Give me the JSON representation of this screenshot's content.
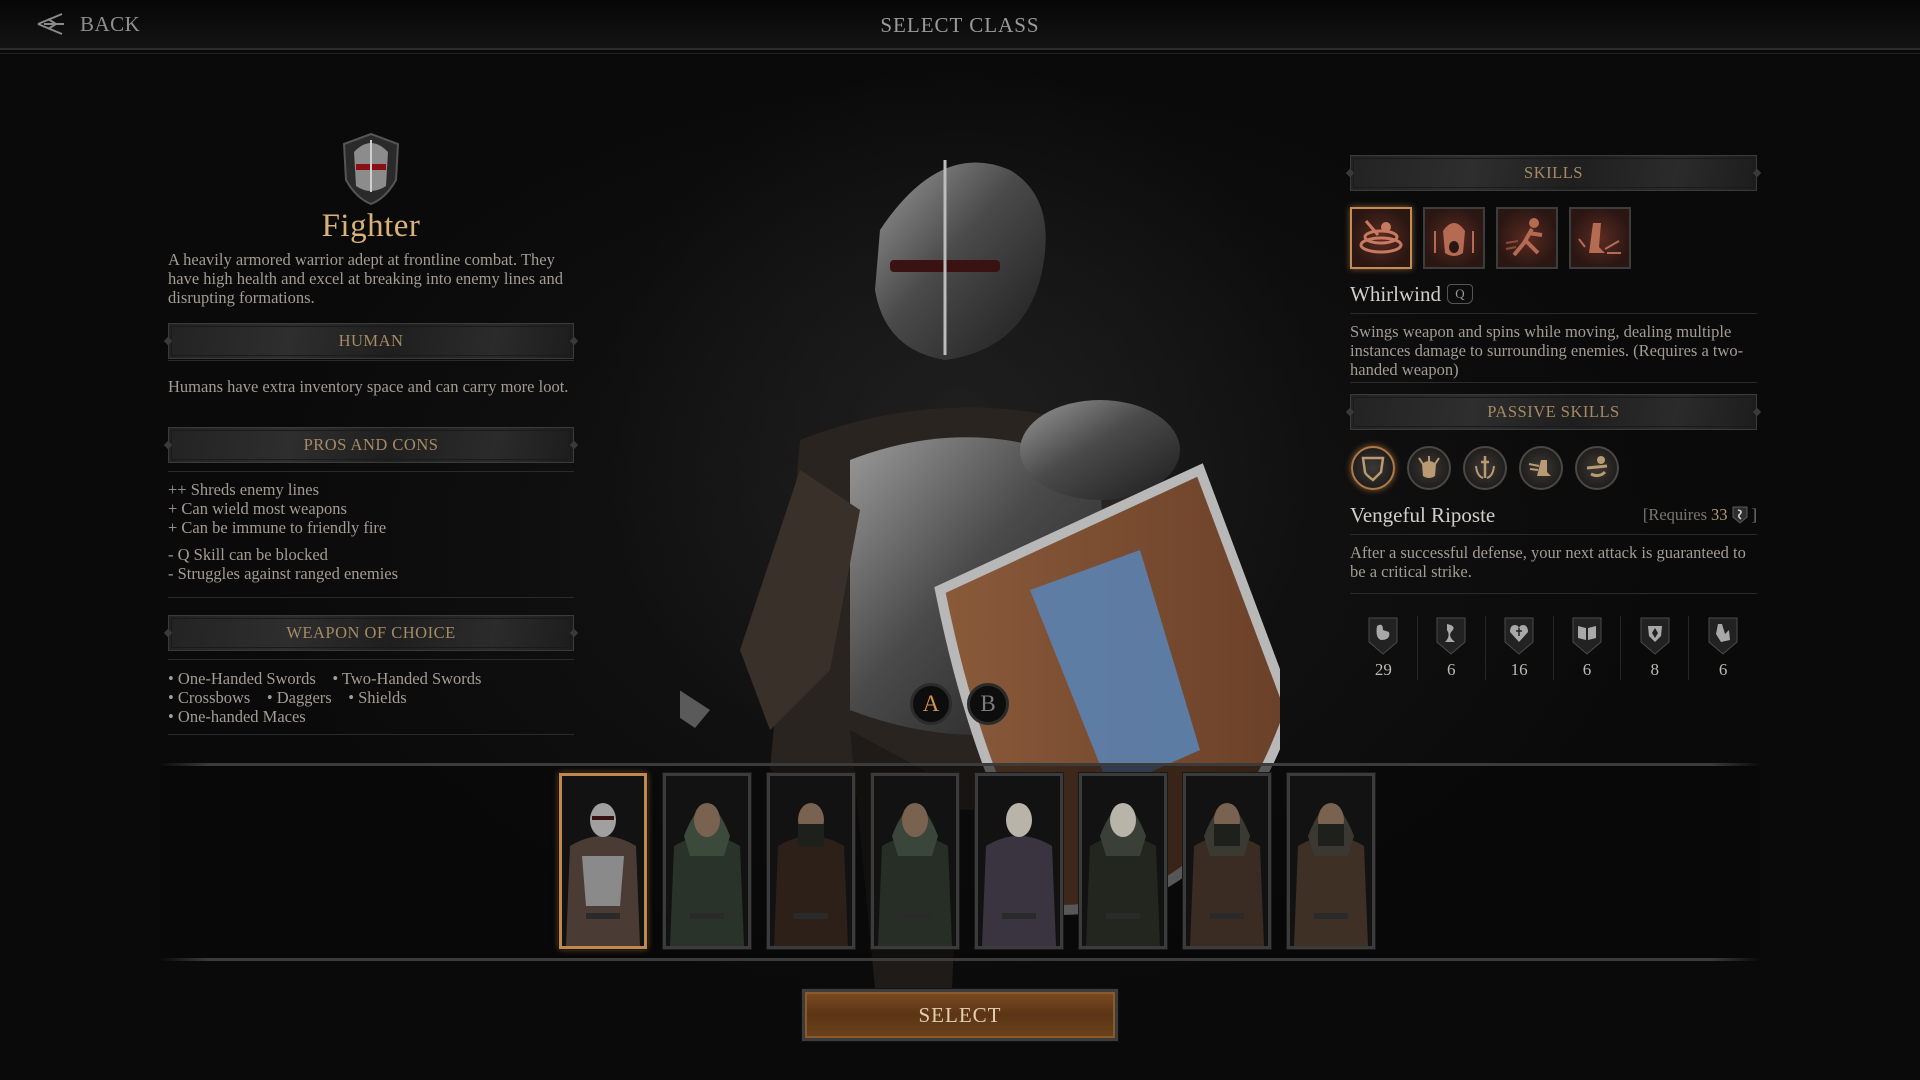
{
  "header": {
    "back_label": "BACK",
    "title": "SELECT CLASS"
  },
  "class": {
    "name": "Fighter",
    "emblem_icon": "knight-helmet-icon",
    "description": "A heavily armored warrior adept at frontline combat. They have high health and excel at breaking into enemy lines and disrupting formations.",
    "race": {
      "header": "HUMAN",
      "description": "Humans have extra inventory space and can carry more loot."
    },
    "pros_cons": {
      "header": "PROS AND CONS",
      "pros": [
        "++ Shreds enemy lines",
        "+ Can wield most weapons",
        "+ Can be immune to friendly fire"
      ],
      "cons": [
        "- Q Skill can be blocked",
        "- Struggles against ranged enemies"
      ]
    },
    "weapons": {
      "header": "WEAPON OF CHOICE",
      "lines": [
        "• One-Handed Swords    • Two-Handed Swords",
        "• Crossbows    • Daggers    • Shields",
        "• One-handed Maces"
      ],
      "items": [
        "One-Handed Swords",
        "Two-Handed Swords",
        "Crossbows",
        "Daggers",
        "Shields",
        "One-handed Maces"
      ]
    }
  },
  "skills": {
    "header": "SKILLS",
    "icons": [
      "whirlwind-icon",
      "war-cry-icon",
      "charge-icon",
      "ground-slam-icon"
    ],
    "selected_index": 0,
    "selected": {
      "name": "Whirlwind",
      "key": "Q",
      "description": "Swings weapon and spins while moving, dealing multiple instances damage to surrounding enemies. (Requires a two-handed weapon)"
    }
  },
  "passives": {
    "header": "PASSIVE SKILLS",
    "icons": [
      "shield-icon",
      "beast-mask-icon",
      "sword-laurel-icon",
      "winged-boot-icon",
      "swift-arm-icon"
    ],
    "selected_index": 0,
    "selected": {
      "name": "Vengeful Riposte",
      "requires_prefix": "[Requires",
      "requires_value": "33",
      "requires_suffix": "]",
      "requires_icon": "agility-icon",
      "description": "After a successful defense, your next attack is guaranteed to be a critical strike."
    }
  },
  "stats": [
    {
      "icon": "strength-icon",
      "value": "29"
    },
    {
      "icon": "agility-icon",
      "value": "6"
    },
    {
      "icon": "vigor-icon",
      "value": "16"
    },
    {
      "icon": "knowledge-icon",
      "value": "6"
    },
    {
      "icon": "will-icon",
      "value": "8"
    },
    {
      "icon": "resourcefulness-icon",
      "value": "6"
    }
  ],
  "skin_toggle": {
    "options": [
      "A",
      "B"
    ],
    "selected": "A"
  },
  "portraits": {
    "selected_index": 0,
    "items": [
      "fighter",
      "hooded-bearded",
      "masked-rogue",
      "hooded-green",
      "skull-armored",
      "skull-hooded",
      "masked-hooded",
      "masked-hunter"
    ]
  },
  "select_button": "SELECT",
  "colors": {
    "accent_gold": "#d8b27a",
    "header_bronze": "#a58a64",
    "selected_border": "#c48b52",
    "select_button": "#6d421d"
  }
}
